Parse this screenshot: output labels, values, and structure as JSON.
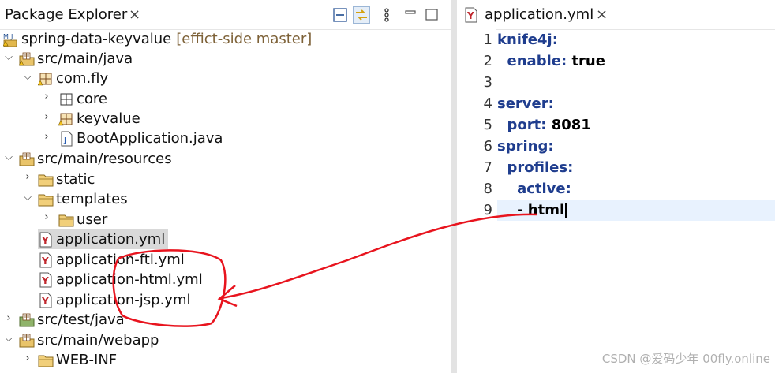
{
  "explorer": {
    "tab_title": "Package Explorer",
    "close_glyph": "×",
    "toolbar_icons": [
      "collapse-all-icon",
      "link-with-editor-icon",
      "view-menu-icon",
      "minimize-icon",
      "maximize-icon"
    ],
    "tree": [
      {
        "label": "spring-data-keyvalue",
        "decoration": "[effict-side master]",
        "icon": "maven-project-icon",
        "expanded": true
      },
      {
        "label": "src/main/java",
        "icon": "source-folder-icon",
        "expanded": true
      },
      {
        "label": "com.fly",
        "icon": "package-icon",
        "expanded": true
      },
      {
        "label": "core",
        "icon": "package-icon",
        "expanded": false
      },
      {
        "label": "keyvalue",
        "icon": "package-icon",
        "expanded": false
      },
      {
        "label": "BootApplication.java",
        "icon": "java-file-icon",
        "expanded": false
      },
      {
        "label": "src/main/resources",
        "icon": "source-folder-icon",
        "expanded": true
      },
      {
        "label": "static",
        "icon": "folder-icon",
        "expanded": false
      },
      {
        "label": "templates",
        "icon": "folder-icon",
        "expanded": true
      },
      {
        "label": "user",
        "icon": "folder-icon",
        "expanded": false
      },
      {
        "label": "application.yml",
        "icon": "yaml-file-icon",
        "selected": true
      },
      {
        "label": "application-ftl.yml",
        "icon": "yaml-file-icon"
      },
      {
        "label": "application-html.yml",
        "icon": "yaml-file-icon"
      },
      {
        "label": "application-jsp.yml",
        "icon": "yaml-file-icon"
      },
      {
        "label": "src/test/java",
        "icon": "source-folder-icon",
        "expanded": false
      },
      {
        "label": "src/main/webapp",
        "icon": "source-folder-icon",
        "expanded": true
      },
      {
        "label": "WEB-INF",
        "icon": "folder-icon",
        "expanded": false
      }
    ]
  },
  "editor": {
    "tab_title": "application.yml",
    "close_glyph": "×",
    "lines": [
      {
        "n": "1",
        "key": "knife4j:",
        "value": ""
      },
      {
        "n": "2",
        "key": "  enable:",
        "value": " true"
      },
      {
        "n": "3",
        "key": "",
        "value": ""
      },
      {
        "n": "4",
        "key": "server:",
        "value": ""
      },
      {
        "n": "5",
        "key": "  port:",
        "value": " 8081"
      },
      {
        "n": "6",
        "key": "spring:",
        "value": ""
      },
      {
        "n": "7",
        "key": "  profiles:",
        "value": ""
      },
      {
        "n": "8",
        "key": "    active:",
        "value": ""
      },
      {
        "n": "9",
        "key": "",
        "value": "    - html"
      }
    ]
  },
  "watermark": "CSDN @爱码少年 00fly.online",
  "colors": {
    "yaml_key": "#1f3d8e",
    "annotation": "#e8141e",
    "current_line": "#e8f2fe",
    "decoration": "#7d6137"
  }
}
